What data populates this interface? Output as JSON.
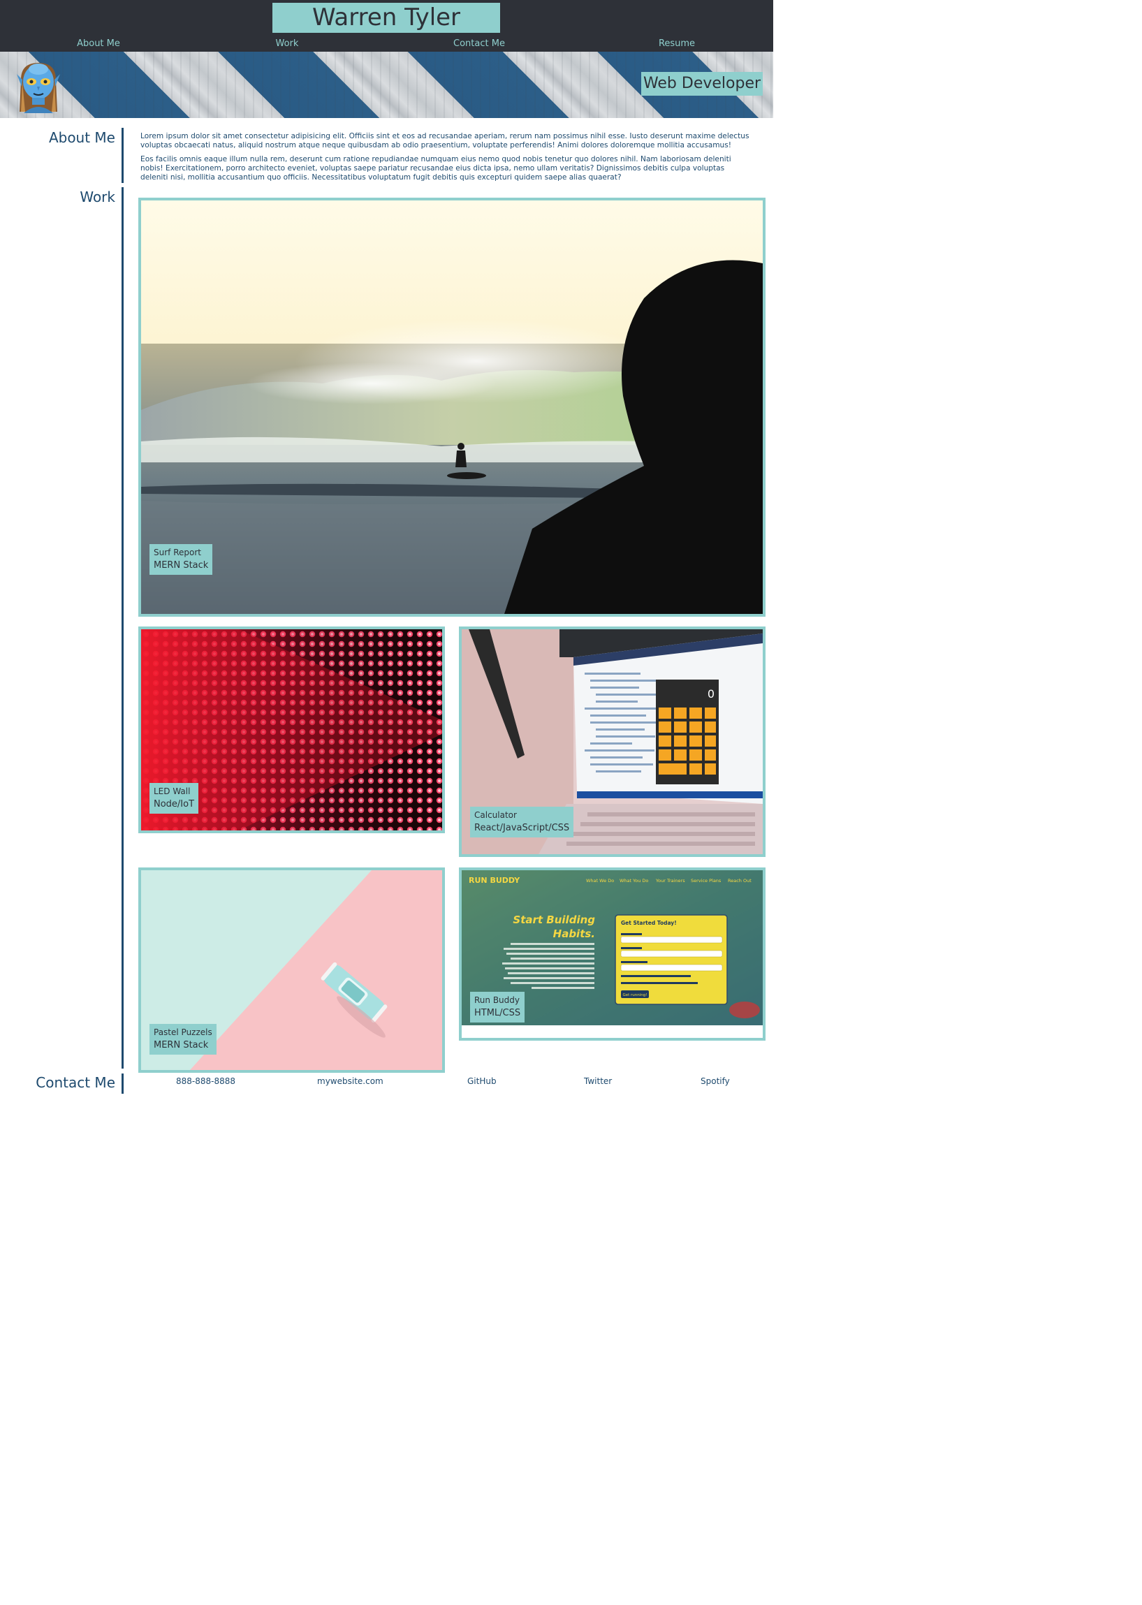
{
  "header": {
    "title": "Warren Tyler",
    "nav": {
      "about": "About Me",
      "work": "Work",
      "contact": "Contact Me",
      "resume": "Resume"
    }
  },
  "hero": {
    "tagline": "Web Developer",
    "avatar_icon": "blue-alien-avatar-icon"
  },
  "about": {
    "label": "About Me",
    "paragraphs": [
      "Lorem ipsum dolor sit amet consectetur adipisicing elit. Officiis sint et eos ad recusandae aperiam, rerum nam possimus nihil esse. Iusto deserunt maxime delectus voluptas obcaecati natus, aliquid nostrum atque neque quibusdam ab odio praesentium, voluptate perferendis! Animi dolores doloremque mollitia accusamus!",
      "Eos facilis omnis eaque illum nulla rem, deserunt cum ratione repudiandae numquam eius nemo quod nobis tenetur quo dolores nihil. Nam laboriosam deleniti nobis! Exercitationem, porro architecto eveniet, voluptas saepe pariatur recusandae eius dicta ipsa, nemo ullam veritatis? Dignissimos debitis culpa voluptas deleniti nisi, mollitia accusantium quo officiis. Necessitatibus voluptatum fugit debitis quis excepturi quidem saepe alias quaerat?"
    ]
  },
  "work": {
    "label": "Work",
    "projects": [
      {
        "name": "Surf Report",
        "stack": "MERN Stack"
      },
      {
        "name": "LED Wall",
        "stack": "Node/IoT"
      },
      {
        "name": "Calculator",
        "stack": "React/JavaScript/CSS"
      },
      {
        "name": "Pastel Puzzels",
        "stack": "MERN Stack"
      },
      {
        "name": "Run Buddy",
        "stack": "HTML/CSS"
      }
    ],
    "run_buddy_preview": {
      "brand": "RUN BUDDY",
      "nav": [
        "What We Do",
        "What You Do",
        "Your Trainers",
        "Service Plans",
        "Reach Out"
      ],
      "headline": [
        "Start Building",
        "Habits."
      ],
      "form_title": "Get Started Today!",
      "form_button": "Get running!"
    },
    "calc_display": "0"
  },
  "contact": {
    "label": "Contact Me",
    "links": {
      "phone": "888-888-8888",
      "website": "mywebsite.com",
      "github": "GitHub",
      "twitter": "Twitter",
      "spotify": "Spotify"
    }
  },
  "colors": {
    "header_bg": "#2e3138",
    "accent": "#8fcfcd",
    "text": "#1e4a6e",
    "hero_stripe": "#2a5b85"
  }
}
